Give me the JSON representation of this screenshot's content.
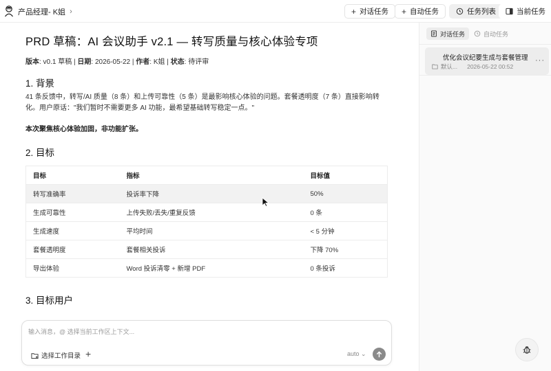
{
  "header": {
    "breadcrumb_title": "产品经理- K姐",
    "chevron": "›",
    "btn_new_chat": "对话任务",
    "btn_new_auto": "自动任务",
    "btn_task_list": "任务列表",
    "btn_current_task": "当前任务",
    "plus_icon": "plus-icon",
    "history_icon": "history-icon",
    "panel_icon": "panel-icon"
  },
  "doc": {
    "title": "PRD 草稿：AI 会议助手 v2.1 — 转写质量与核心体验专项",
    "meta": {
      "version_label": "版本",
      "version_value": ": v0.1 草稿 | ",
      "date_label": "日期",
      "date_value": ": 2026-05-22 | ",
      "author_label": "作者",
      "author_value": ": K姐 | ",
      "status_label": "状态",
      "status_value": ": 待评审"
    },
    "section1_title": "1. 背景",
    "section1_para": "41 条反馈中，转写/AI 质量（8 条）和上传可靠性（5 条）是最影响核心体验的问题。套餐透明度（7 条）直接影响转化。用户原话：\"我们暂时不需要更多 AI 功能，最希望基础转写稳定一点。\"",
    "section1_bold": "本次聚焦核心体验加固，非功能扩张。",
    "section2_title": "2. 目标",
    "table_headers": [
      "目标",
      "指标",
      "目标值"
    ],
    "table_rows": [
      [
        "转写准确率",
        "投诉率下降",
        "50%"
      ],
      [
        "生成可靠性",
        "上传失败/丢失/重复反馈",
        "0 条"
      ],
      [
        "生成速度",
        "平均时间",
        "< 5 分钟"
      ],
      [
        "套餐透明度",
        "套餐相关投诉",
        "下降 70%"
      ],
      [
        "导出体验",
        "Word 投诉清零 + 新增 PDF",
        "0 条投诉"
      ]
    ],
    "section3_title": "3. 目标用户"
  },
  "composer": {
    "placeholder": "输入消息，@ 选择当前工作区上下文...",
    "workdir_label": "选择工作目录",
    "plus": "+",
    "model": "auto ⌄",
    "send_icon": "arrow-up-icon"
  },
  "panel": {
    "tab_chat": "对话任务",
    "tab_auto": "自动任务",
    "task": {
      "title": "优化会议纪要生成与套餐管理",
      "folder": "默认...",
      "time": "2026-05-22 00:52",
      "more": "···"
    }
  },
  "colors": {
    "accent_bg": "#efefef",
    "border": "#ececec",
    "text": "#1f1f1f",
    "muted": "#9a9a9a"
  }
}
